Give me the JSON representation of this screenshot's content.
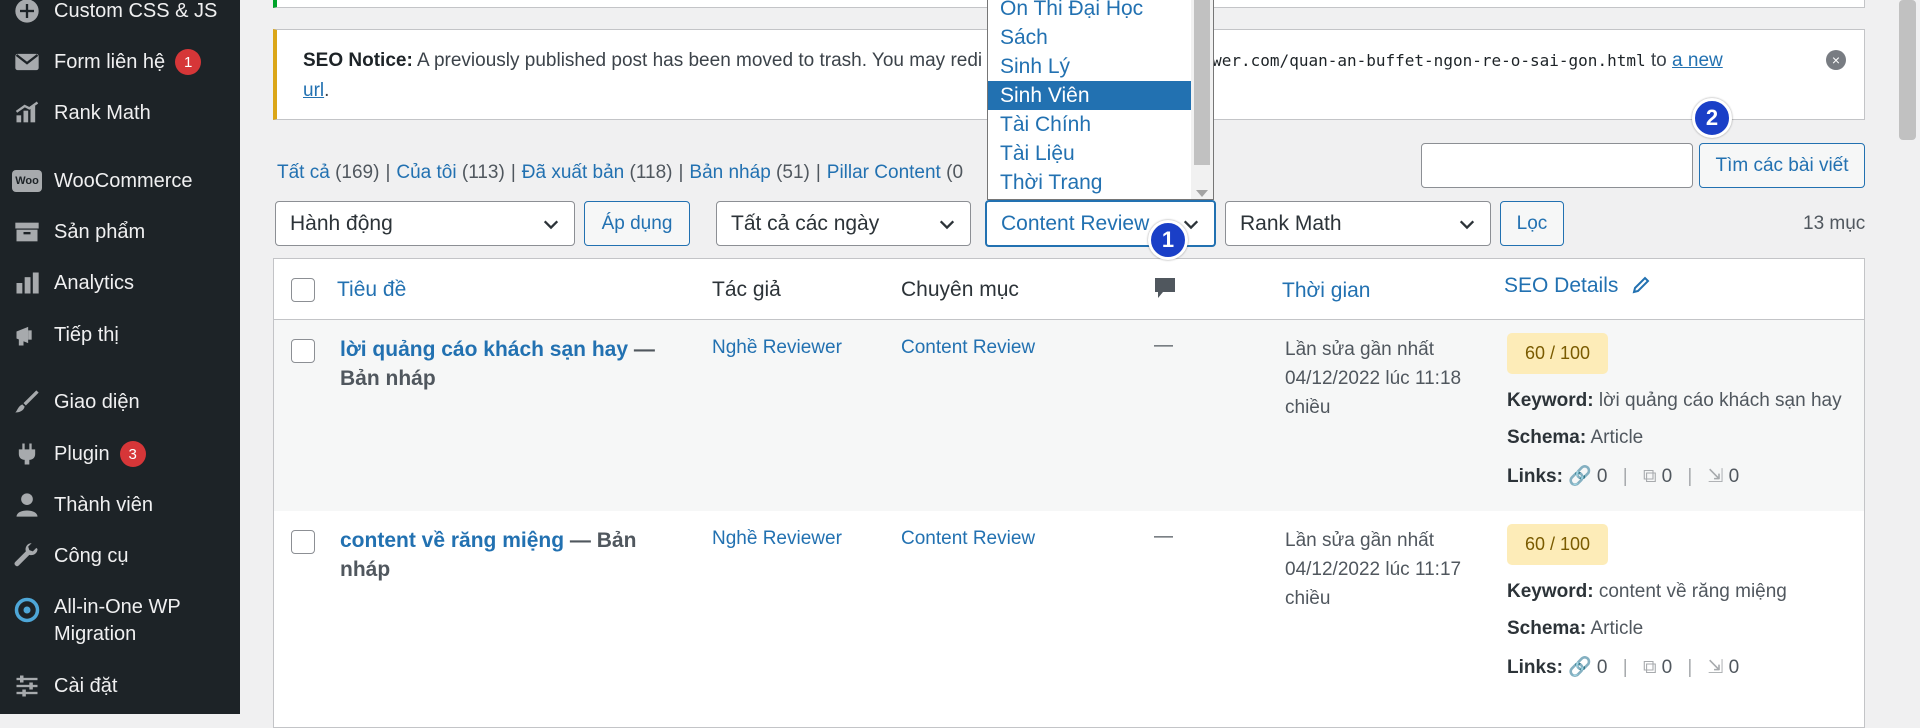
{
  "sidebar": {
    "items": [
      {
        "label": "Custom CSS & JS",
        "icon": "plus-circle-icon"
      },
      {
        "label": "Form liên hệ",
        "icon": "mail-icon",
        "badge": "1"
      },
      {
        "label": "Rank Math",
        "icon": "rank-math-icon"
      },
      {
        "label": "WooCommerce",
        "icon": "woocommerce-icon"
      },
      {
        "label": "Sản phẩm",
        "icon": "archive-icon"
      },
      {
        "label": "Analytics",
        "icon": "bar-chart-icon"
      },
      {
        "label": "Tiếp thị",
        "icon": "megaphone-icon"
      },
      {
        "label": "Giao diện",
        "icon": "paintbrush-icon"
      },
      {
        "label": "Plugin",
        "icon": "plugin-icon",
        "badge": "3"
      },
      {
        "label": "Thành viên",
        "icon": "user-icon"
      },
      {
        "label": "Công cụ",
        "icon": "wrench-icon"
      },
      {
        "label": "All-in-One WP Migration",
        "icon": "migration-icon"
      },
      {
        "label": "Cài đặt",
        "icon": "settings-sliders-icon"
      }
    ],
    "woo_icon_text": "Woo"
  },
  "notice": {
    "prefix": "SEO Notice:",
    "text": "A previously published post has been moved to trash. You may redi",
    "url_fragment": "wer.com/quan-an-buffet-ngon-re-o-sai-gon.html",
    "to": "to",
    "link_a": "a new",
    "link_b": "url",
    "period": ".",
    "close": "×"
  },
  "filters_links": [
    {
      "label": "Tất cả",
      "count": "(169)"
    },
    {
      "label": "Của tôi",
      "count": "(113)"
    },
    {
      "label": "Đã xuất bản",
      "count": "(118)"
    },
    {
      "label": "Bản nháp",
      "count": "(51)"
    },
    {
      "label": "Pillar Content",
      "count": "(0"
    }
  ],
  "search": {
    "value": "",
    "button": "Tìm các bài viết"
  },
  "toolbar": {
    "bulk_action": "Hành động",
    "apply": "Áp dụng",
    "dates": "Tất cả các ngày",
    "category": "Content Review",
    "rank_math": "Rank Math",
    "filter": "Lọc",
    "items_count": "13 mục"
  },
  "category_dropdown": {
    "options": [
      "Ôn Thi Đại Học",
      "Sách",
      "Sinh Lý",
      "Sinh Viên",
      "Tài Chính",
      "Tài Liệu",
      "Thời Trang"
    ],
    "selected": "Sinh Viên"
  },
  "steps": {
    "one": "1",
    "two": "2"
  },
  "table": {
    "headers": {
      "title": "Tiêu đề",
      "author": "Tác giả",
      "category": "Chuyên mục",
      "comments_icon": "comment-icon",
      "date": "Thời gian",
      "seo": "SEO Details"
    },
    "rows": [
      {
        "title": "lời quảng cáo khách sạn hay",
        "state": "— Bản nháp",
        "author": "Nghề Reviewer",
        "category": "Content Review",
        "comments": "—",
        "date_label": "Lần sửa gần nhất",
        "date_value": "04/12/2022 lúc 11:18",
        "date_suffix": "chiều",
        "score": "60 / 100",
        "keyword_label": "Keyword:",
        "keyword": "lời quảng cáo khách sạn hay",
        "schema_label": "Schema:",
        "schema": "Article",
        "links_label": "Links:",
        "internal": "0",
        "external": "0",
        "incoming": "0"
      },
      {
        "title": "content về răng miệng",
        "state": "— Bản nháp",
        "author": "Nghề Reviewer",
        "category": "Content Review",
        "comments": "—",
        "date_label": "Lần sửa gần nhất",
        "date_value": "04/12/2022 lúc 11:17",
        "date_suffix": "chiều",
        "score": "60 / 100",
        "keyword_label": "Keyword:",
        "keyword": "content về răng miệng",
        "schema_label": "Schema:",
        "schema": "Article",
        "links_label": "Links:",
        "internal": "0",
        "external": "0",
        "incoming": "0"
      }
    ]
  },
  "colors": {
    "sidebar_bg": "#1d2327",
    "link": "#2271b1",
    "notice_border": "#dba617",
    "badge": "#d63638",
    "score_bg": "#fdecb8",
    "step_marker": "#1a3fc7"
  }
}
